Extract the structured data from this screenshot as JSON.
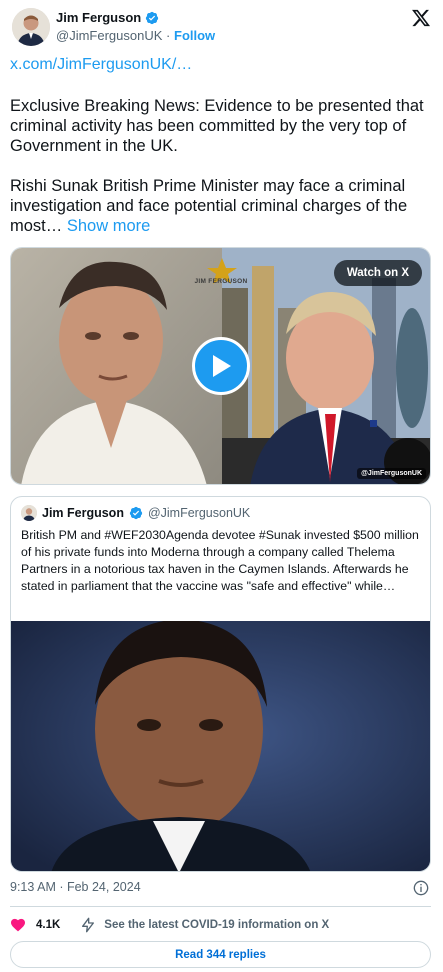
{
  "author": {
    "name": "Jim Ferguson",
    "handle": "@JimFergusonUK",
    "separator": "·",
    "follow_label": "Follow"
  },
  "tweet": {
    "link": "x.com/JimFergusonUK/…",
    "paragraph1": "Exclusive Breaking News: Evidence to be presented that criminal activity has been committed by the very top of Government in the UK.",
    "paragraph2": "Rishi Sunak British Prime Minister may face a criminal investigation and face potential criminal charges of the most…",
    "show_more": "Show more"
  },
  "video": {
    "watch_label": "Watch on X",
    "logo_text": "JIM FERGUSON",
    "watermark": "@JimFergusonUK"
  },
  "quote": {
    "name": "Jim Ferguson",
    "handle": "@JimFergusonUK",
    "text": "British PM and #WEF2030Agenda devotee #Sunak      invested $500 million of his private funds into Moderna through a company called Thelema Partners in a notorious tax haven in the Caymen Islands. Afterwards he stated in parliament that the vaccine was \"safe and effective\" while…"
  },
  "meta": {
    "timestamp": "9:13 AM · Feb 24, 2024"
  },
  "actions": {
    "like_count": "4.1K",
    "covid_label": "See the latest COVID-19 information on X",
    "replies_label": "Read 344 replies"
  },
  "icons": {
    "verified": "verified-badge-icon",
    "x_logo": "x-logo-icon",
    "play": "play-icon",
    "heart": "heart-icon",
    "bolt": "lightning-icon",
    "info": "info-icon"
  },
  "colors": {
    "accent": "#1d9bf0",
    "text": "#0f1419",
    "muted": "#536471",
    "heart": "#f91880",
    "border": "#cfd9de"
  }
}
